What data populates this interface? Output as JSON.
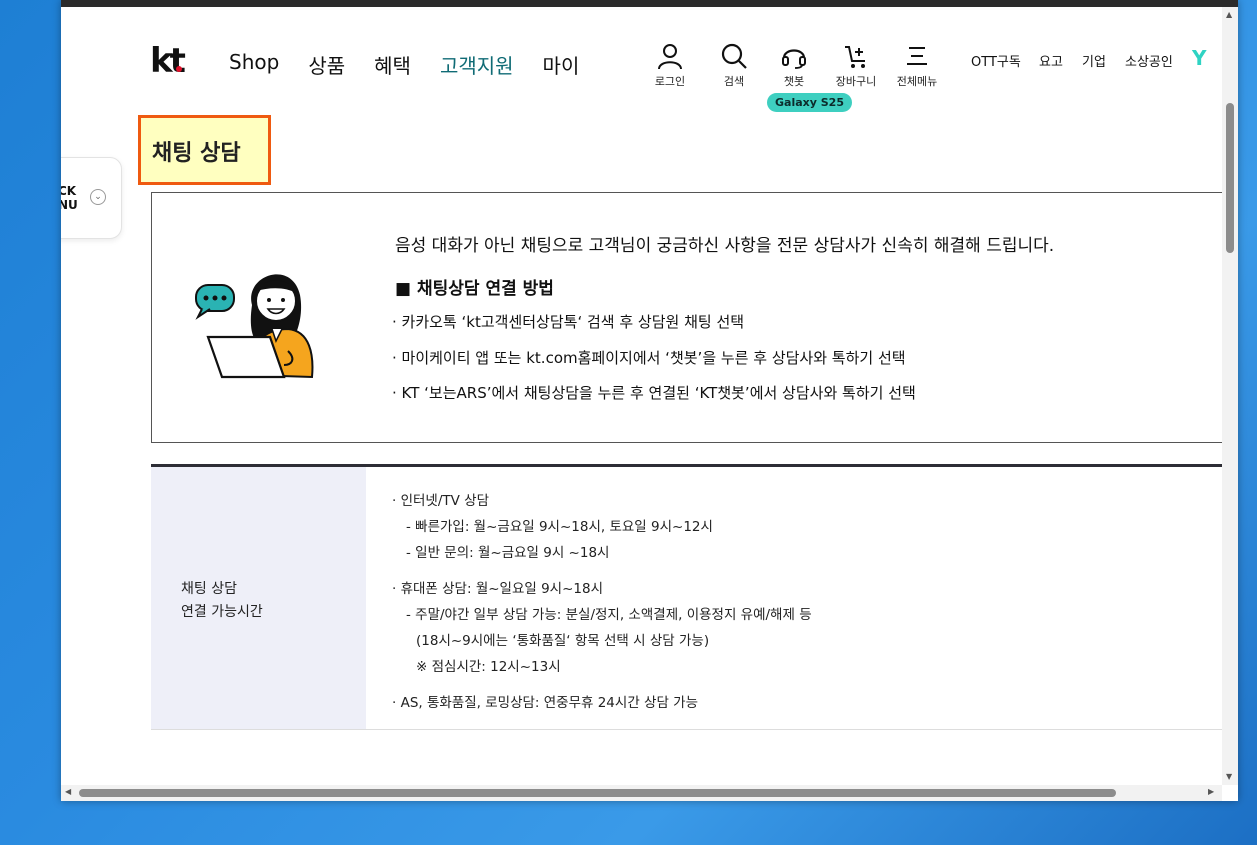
{
  "header": {
    "logo": "kt",
    "nav": [
      "Shop",
      "상품",
      "혜택",
      "고객지원",
      "마이"
    ],
    "active_nav": "고객지원",
    "util": [
      {
        "icon": "person-icon",
        "label": "로그인"
      },
      {
        "icon": "search-icon",
        "label": "검색"
      },
      {
        "icon": "headset-icon",
        "label": "챗봇"
      },
      {
        "icon": "cart-icon",
        "label": "장바구니"
      },
      {
        "icon": "menu-icon",
        "label": "전체메뉴"
      }
    ],
    "promo_badge": "Galaxy S25",
    "links": [
      "OTT구독",
      "요고",
      "기업",
      "소상공인"
    ],
    "y_logo": "Y"
  },
  "quick_menu": {
    "line1": "CK",
    "line2": "NU"
  },
  "page_title": "채팅 상담",
  "info": {
    "intro": "음성 대화가 아닌 채팅으로 고객님이 궁금하신 사항을 전문 상담사가 신속히 해결해 드립니다.",
    "how_title": "■ 채팅상담 연결 방법",
    "steps": [
      "· 카카오톡 ‘kt고객센터상담톡‘ 검색 후 상담원 채팅 선택",
      "· 마이케이티 앱 또는 kt.com홈페이지에서 ‘챗봇’을 누른 후 상담사와 톡하기 선택",
      "· KT ‘보는ARS’에서 채팅상담을 누른 후 연결된 ‘KT챗봇’에서 상담사와 톡하기 선택"
    ]
  },
  "hours": {
    "head_line1": "채팅 상담",
    "head_line2": "연결 가능시간",
    "lines": [
      "· 인터넷/TV 상담",
      "- 빠른가입: 월~금요일 9시~18시, 토요일 9시~12시",
      "- 일반 문의: 월~금요일 9시 ~18시",
      "· 휴대폰 상담: 월~일요일 9시~18시",
      "- 주말/야간 일부 상담 가능: 분실/정지, 소액결제, 이용정지 유예/해제 등",
      "(18시~9시에는 ‘통화품질‘ 항목 선택 시 상담 가능)",
      "※ 점심시간: 12시~13시",
      "· AS, 통화품질, 로밍상담: 연중무휴 24시간 상담 가능"
    ]
  },
  "colors": {
    "accent": "#0f6b75",
    "title_border": "#ef5a10",
    "title_bg": "#ffffc0",
    "badge": "#3ecfc0"
  }
}
